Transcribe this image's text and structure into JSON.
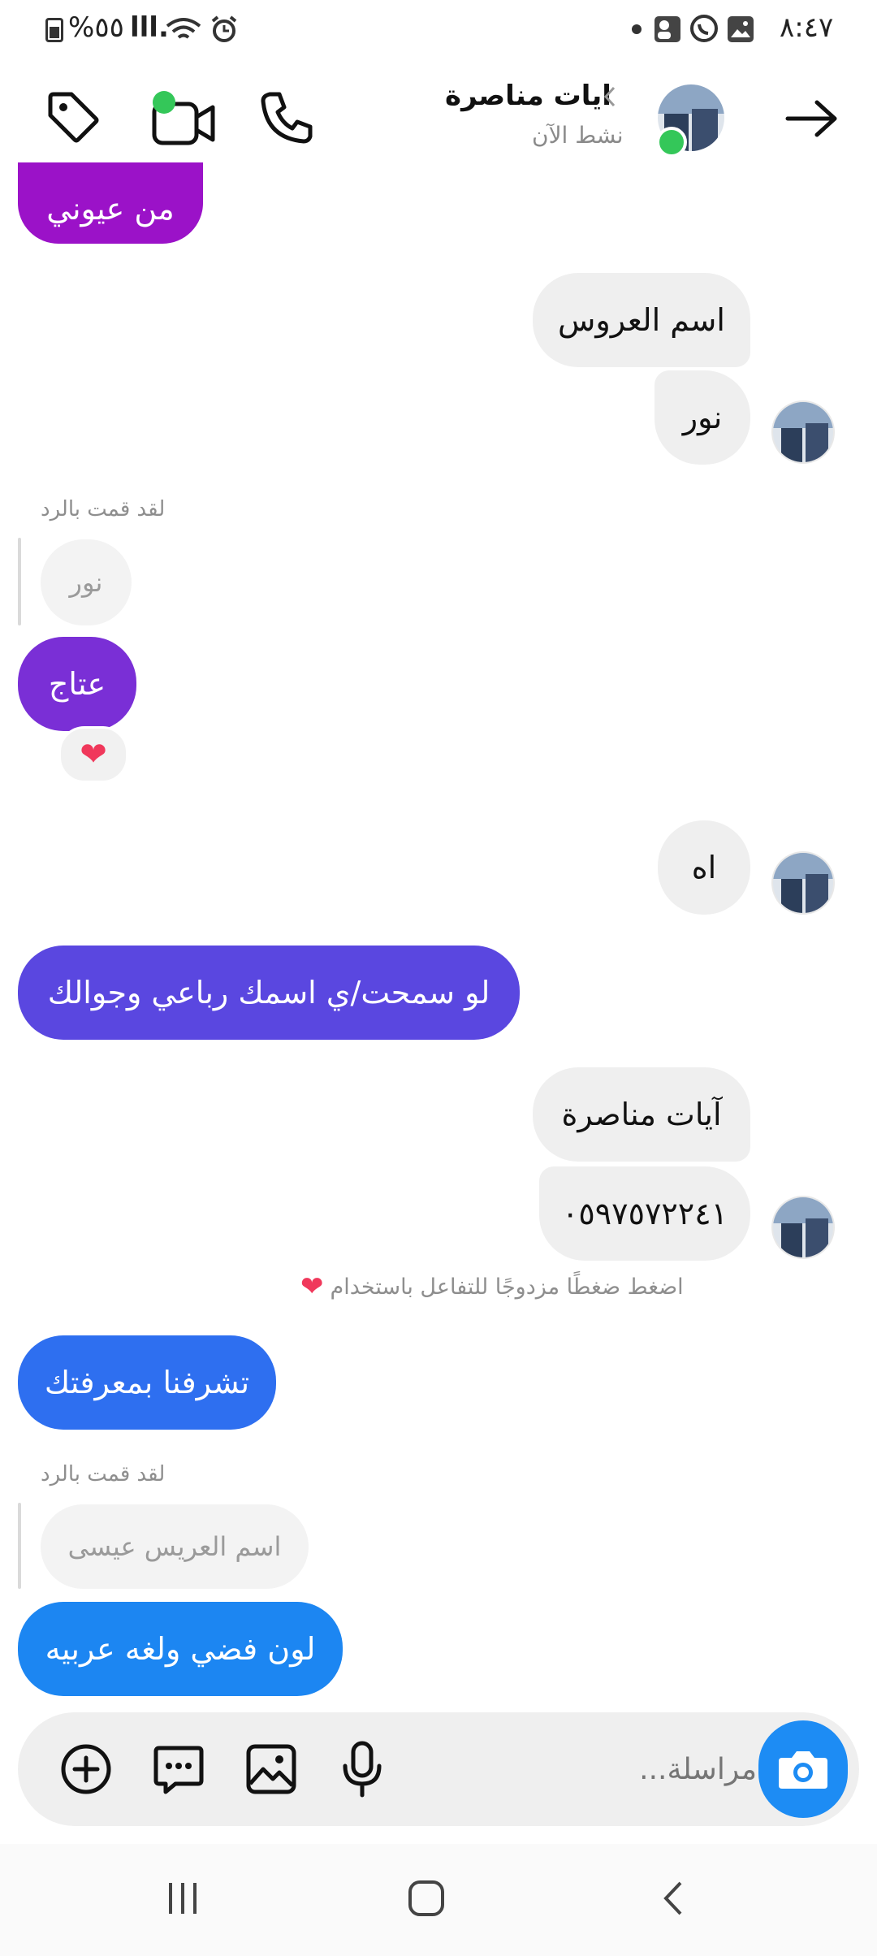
{
  "status_bar": {
    "time": "٨:٤٧",
    "battery": "%٥٥",
    "signal": "lll."
  },
  "header": {
    "name": "ايات مناصرة",
    "activity": "نشط الآن"
  },
  "messages": {
    "m1": "من عيوني",
    "m2": "اسم العروس",
    "m3": "نور",
    "reply_note_1": "لقد قمت بالرد",
    "quoted_1": "نور",
    "m4": "عتاج",
    "reaction_1": "❤",
    "m5": "اه",
    "m6": "لو سمحت/ي اسمك رباعي وجوالك",
    "m7": "آيات مناصرة",
    "m8": "٠٥٩٧٥٧٢٢٤١",
    "hint": "اضغط ضغطًا مزدوجًا للتفاعل باستخدام",
    "hint_heart": "❤",
    "m9": "تشرفنا بمعرفتك",
    "reply_note_2": "لقد قمت بالرد",
    "quoted_2": "اسم العريس عيسى",
    "m10": "لون فضي ولغه عربيه"
  },
  "composer": {
    "placeholder": "مراسلة..."
  },
  "colors": {
    "purple_1": "#9b12c8",
    "purple_2": "#7a2fd6",
    "indigo": "#5a47e0",
    "blue_1": "#2e6ff0",
    "blue_2": "#1c86f2",
    "online": "#34c759",
    "camera_btn": "#1d8cf4"
  }
}
